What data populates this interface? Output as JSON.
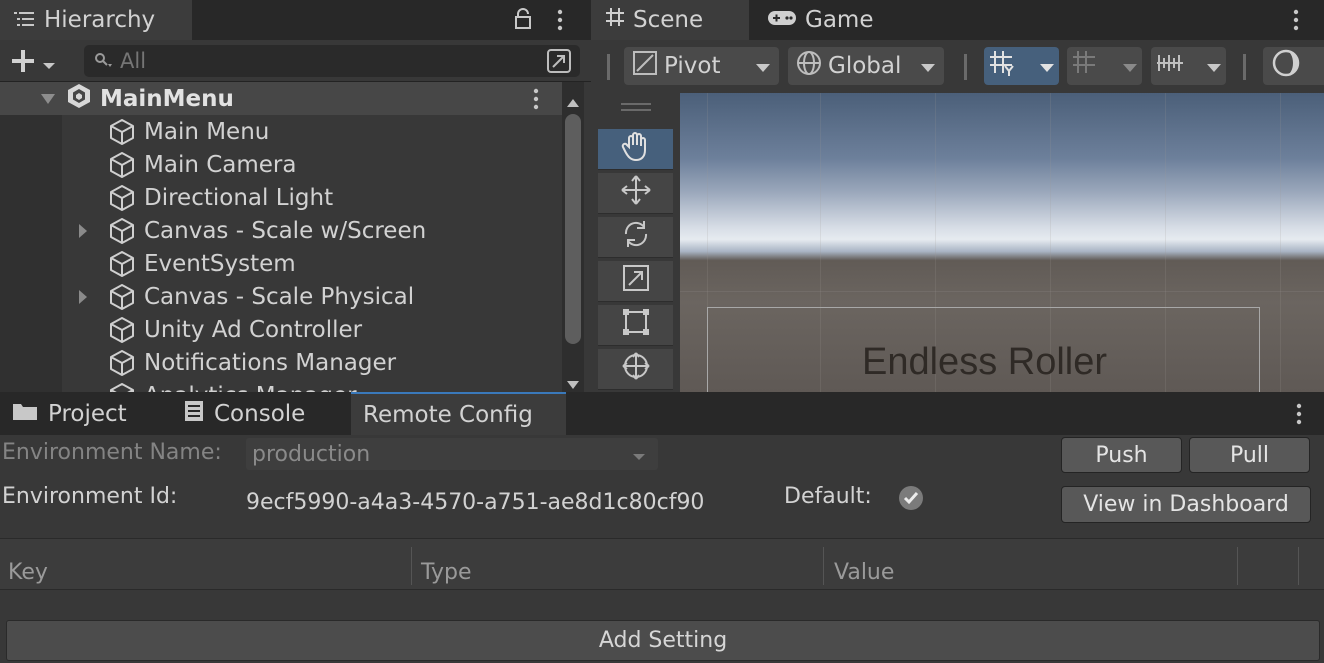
{
  "hierarchy": {
    "tab_label": "Hierarchy",
    "search_placeholder": "All",
    "scene_name": "MainMenu",
    "items": [
      {
        "label": "Main Menu",
        "expandable": false
      },
      {
        "label": "Main Camera",
        "expandable": false
      },
      {
        "label": "Directional Light",
        "expandable": false
      },
      {
        "label": "Canvas - Scale w/Screen",
        "expandable": true
      },
      {
        "label": "EventSystem",
        "expandable": false
      },
      {
        "label": "Canvas - Scale Physical",
        "expandable": true
      },
      {
        "label": "Unity Ad Controller",
        "expandable": false
      },
      {
        "label": "Notifications Manager",
        "expandable": false
      },
      {
        "label": "Analytics Manager",
        "expandable": false
      }
    ]
  },
  "scene": {
    "tab_scene": "Scene",
    "tab_game": "Game",
    "pivot_label": "Pivot",
    "global_label": "Global",
    "canvas_title": "Endless Roller"
  },
  "bottom": {
    "tabs": [
      "Project",
      "Console",
      "Remote Config"
    ],
    "env_name_label": "Environment Name:",
    "env_name_value": "production",
    "env_id_label": "Environment Id:",
    "env_id_value": "9ecf5990-a4a3-4570-a751-ae8d1c80cf90",
    "default_label": "Default:",
    "push_label": "Push",
    "pull_label": "Pull",
    "dashboard_label": "View in Dashboard",
    "columns": [
      "Key",
      "Type",
      "Value"
    ],
    "add_setting_label": "Add Setting"
  },
  "colors": {
    "accent_blue": "#46607c",
    "panel_bg": "#383838",
    "tab_bg": "#282828"
  }
}
